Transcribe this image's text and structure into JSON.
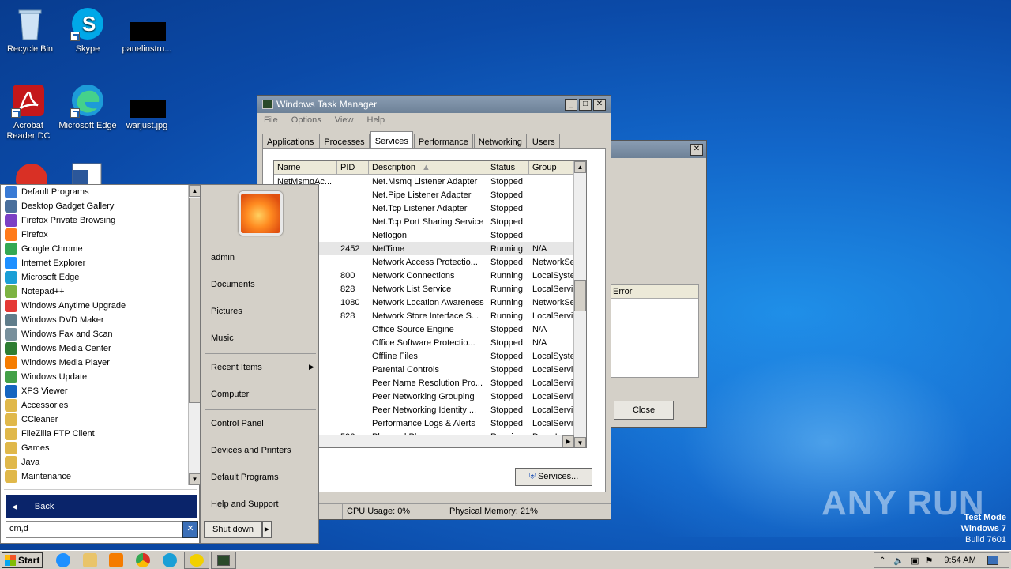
{
  "desktop": {
    "icons": [
      {
        "label": "Recycle Bin"
      },
      {
        "label": "Skype"
      },
      {
        "label": "panelinstru..."
      },
      {
        "label": "Acrobat Reader DC"
      },
      {
        "label": "Microsoft Edge"
      },
      {
        "label": "warjust.jpg"
      }
    ],
    "watermark": {
      "brand": "ANY RUN",
      "line1": "Test Mode",
      "line2": "Windows 7",
      "line3": "Build 7601"
    }
  },
  "task_manager": {
    "title": "Windows Task Manager",
    "menu": [
      "File",
      "Options",
      "View",
      "Help"
    ],
    "tabs": [
      "Applications",
      "Processes",
      "Services",
      "Performance",
      "Networking",
      "Users"
    ],
    "active_tab": "Services",
    "columns": [
      "Name",
      "PID",
      "Description",
      "Status",
      "Group"
    ],
    "rows": [
      {
        "name": "NetMsmqAc...",
        "pid": "",
        "desc": "Net.Msmq Listener Adapter",
        "status": "Stopped",
        "group": ""
      },
      {
        "name": "...cti...",
        "pid": "",
        "desc": "Net.Pipe Listener Adapter",
        "status": "Stopped",
        "group": ""
      },
      {
        "name": "...tiv...",
        "pid": "",
        "desc": "Net.Tcp Listener Adapter",
        "status": "Stopped",
        "group": ""
      },
      {
        "name": "...rt...",
        "pid": "",
        "desc": "Net.Tcp Port Sharing Service",
        "status": "Stopped",
        "group": ""
      },
      {
        "name": "",
        "pid": "",
        "desc": "Netlogon",
        "status": "Stopped",
        "group": ""
      },
      {
        "name": "...vc",
        "pid": "2452",
        "desc": "NetTime",
        "status": "Running",
        "group": "N/A"
      },
      {
        "name": "",
        "pid": "",
        "desc": "Network Access Protectio...",
        "status": "Stopped",
        "group": "NetworkSe"
      },
      {
        "name": "",
        "pid": "800",
        "desc": "Network Connections",
        "status": "Running",
        "group": "LocalSyste"
      },
      {
        "name": "",
        "pid": "828",
        "desc": "Network List Service",
        "status": "Running",
        "group": "LocalServic"
      },
      {
        "name": "",
        "pid": "1080",
        "desc": "Network Location Awareness",
        "status": "Running",
        "group": "NetworkSe"
      },
      {
        "name": "",
        "pid": "828",
        "desc": "Network Store Interface S...",
        "status": "Running",
        "group": "LocalServic"
      },
      {
        "name": "",
        "pid": "",
        "desc": "Office  Source Engine",
        "status": "Stopped",
        "group": "N/A"
      },
      {
        "name": "",
        "pid": "",
        "desc": "Office Software Protectio...",
        "status": "Stopped",
        "group": "N/A"
      },
      {
        "name": "...e",
        "pid": "",
        "desc": "Offline Files",
        "status": "Stopped",
        "group": "LocalSyste"
      },
      {
        "name": "",
        "pid": "",
        "desc": "Parental Controls",
        "status": "Stopped",
        "group": "LocalServic"
      },
      {
        "name": "",
        "pid": "",
        "desc": "Peer Name Resolution Pro...",
        "status": "Stopped",
        "group": "LocalServic"
      },
      {
        "name": "",
        "pid": "",
        "desc": "Peer Networking Grouping",
        "status": "Stopped",
        "group": "LocalServic"
      },
      {
        "name": "",
        "pid": "",
        "desc": "Peer Networking Identity ...",
        "status": "Stopped",
        "group": "LocalServic"
      },
      {
        "name": "",
        "pid": "",
        "desc": "Performance Logs & Alerts",
        "status": "Stopped",
        "group": "LocalServic"
      },
      {
        "name": "",
        "pid": "596",
        "desc": "Plug and Play",
        "status": "Running",
        "group": "DcomLaun..."
      }
    ],
    "services_button": "Services...",
    "status_cpu": "CPU Usage: 0%",
    "status_mem": "Physical Memory: 21%"
  },
  "bg_dialog": {
    "column_label": "Error",
    "close_button": "Close"
  },
  "start_menu": {
    "programs": [
      {
        "label": "Default Programs",
        "color": "#3a7bd5"
      },
      {
        "label": "Desktop Gadget Gallery",
        "color": "#4a6f9c"
      },
      {
        "label": "Firefox Private Browsing",
        "color": "#7b3fc4"
      },
      {
        "label": "Firefox",
        "color": "#ff7a1a"
      },
      {
        "label": "Google Chrome",
        "color": "#34a853"
      },
      {
        "label": "Internet Explorer",
        "color": "#1e90ff"
      },
      {
        "label": "Microsoft Edge",
        "color": "#1a9fd6"
      },
      {
        "label": "Notepad++",
        "color": "#7cb342"
      },
      {
        "label": "Windows Anytime Upgrade",
        "color": "#e53935"
      },
      {
        "label": "Windows DVD Maker",
        "color": "#607d8b"
      },
      {
        "label": "Windows Fax and Scan",
        "color": "#78909c"
      },
      {
        "label": "Windows Media Center",
        "color": "#2e7d32"
      },
      {
        "label": "Windows Media Player",
        "color": "#f57c00"
      },
      {
        "label": "Windows Update",
        "color": "#43a047"
      },
      {
        "label": "XPS Viewer",
        "color": "#1565c0"
      },
      {
        "label": "Accessories",
        "color": "#e0b84a"
      },
      {
        "label": "CCleaner",
        "color": "#e0b84a"
      },
      {
        "label": "FileZilla FTP Client",
        "color": "#e0b84a"
      },
      {
        "label": "Games",
        "color": "#e0b84a"
      },
      {
        "label": "Java",
        "color": "#e0b84a"
      },
      {
        "label": "Maintenance",
        "color": "#e0b84a"
      }
    ],
    "back_label": "Back",
    "search_value": "cm,d",
    "right_items": {
      "user": "admin",
      "documents": "Documents",
      "pictures": "Pictures",
      "music": "Music",
      "recent": "Recent Items",
      "computer": "Computer",
      "control_panel": "Control Panel",
      "devices": "Devices and Printers",
      "default_programs": "Default Programs",
      "help": "Help and Support"
    },
    "shutdown_label": "Shut down"
  },
  "taskbar": {
    "start_label": "Start",
    "clock": "9:54 AM"
  }
}
